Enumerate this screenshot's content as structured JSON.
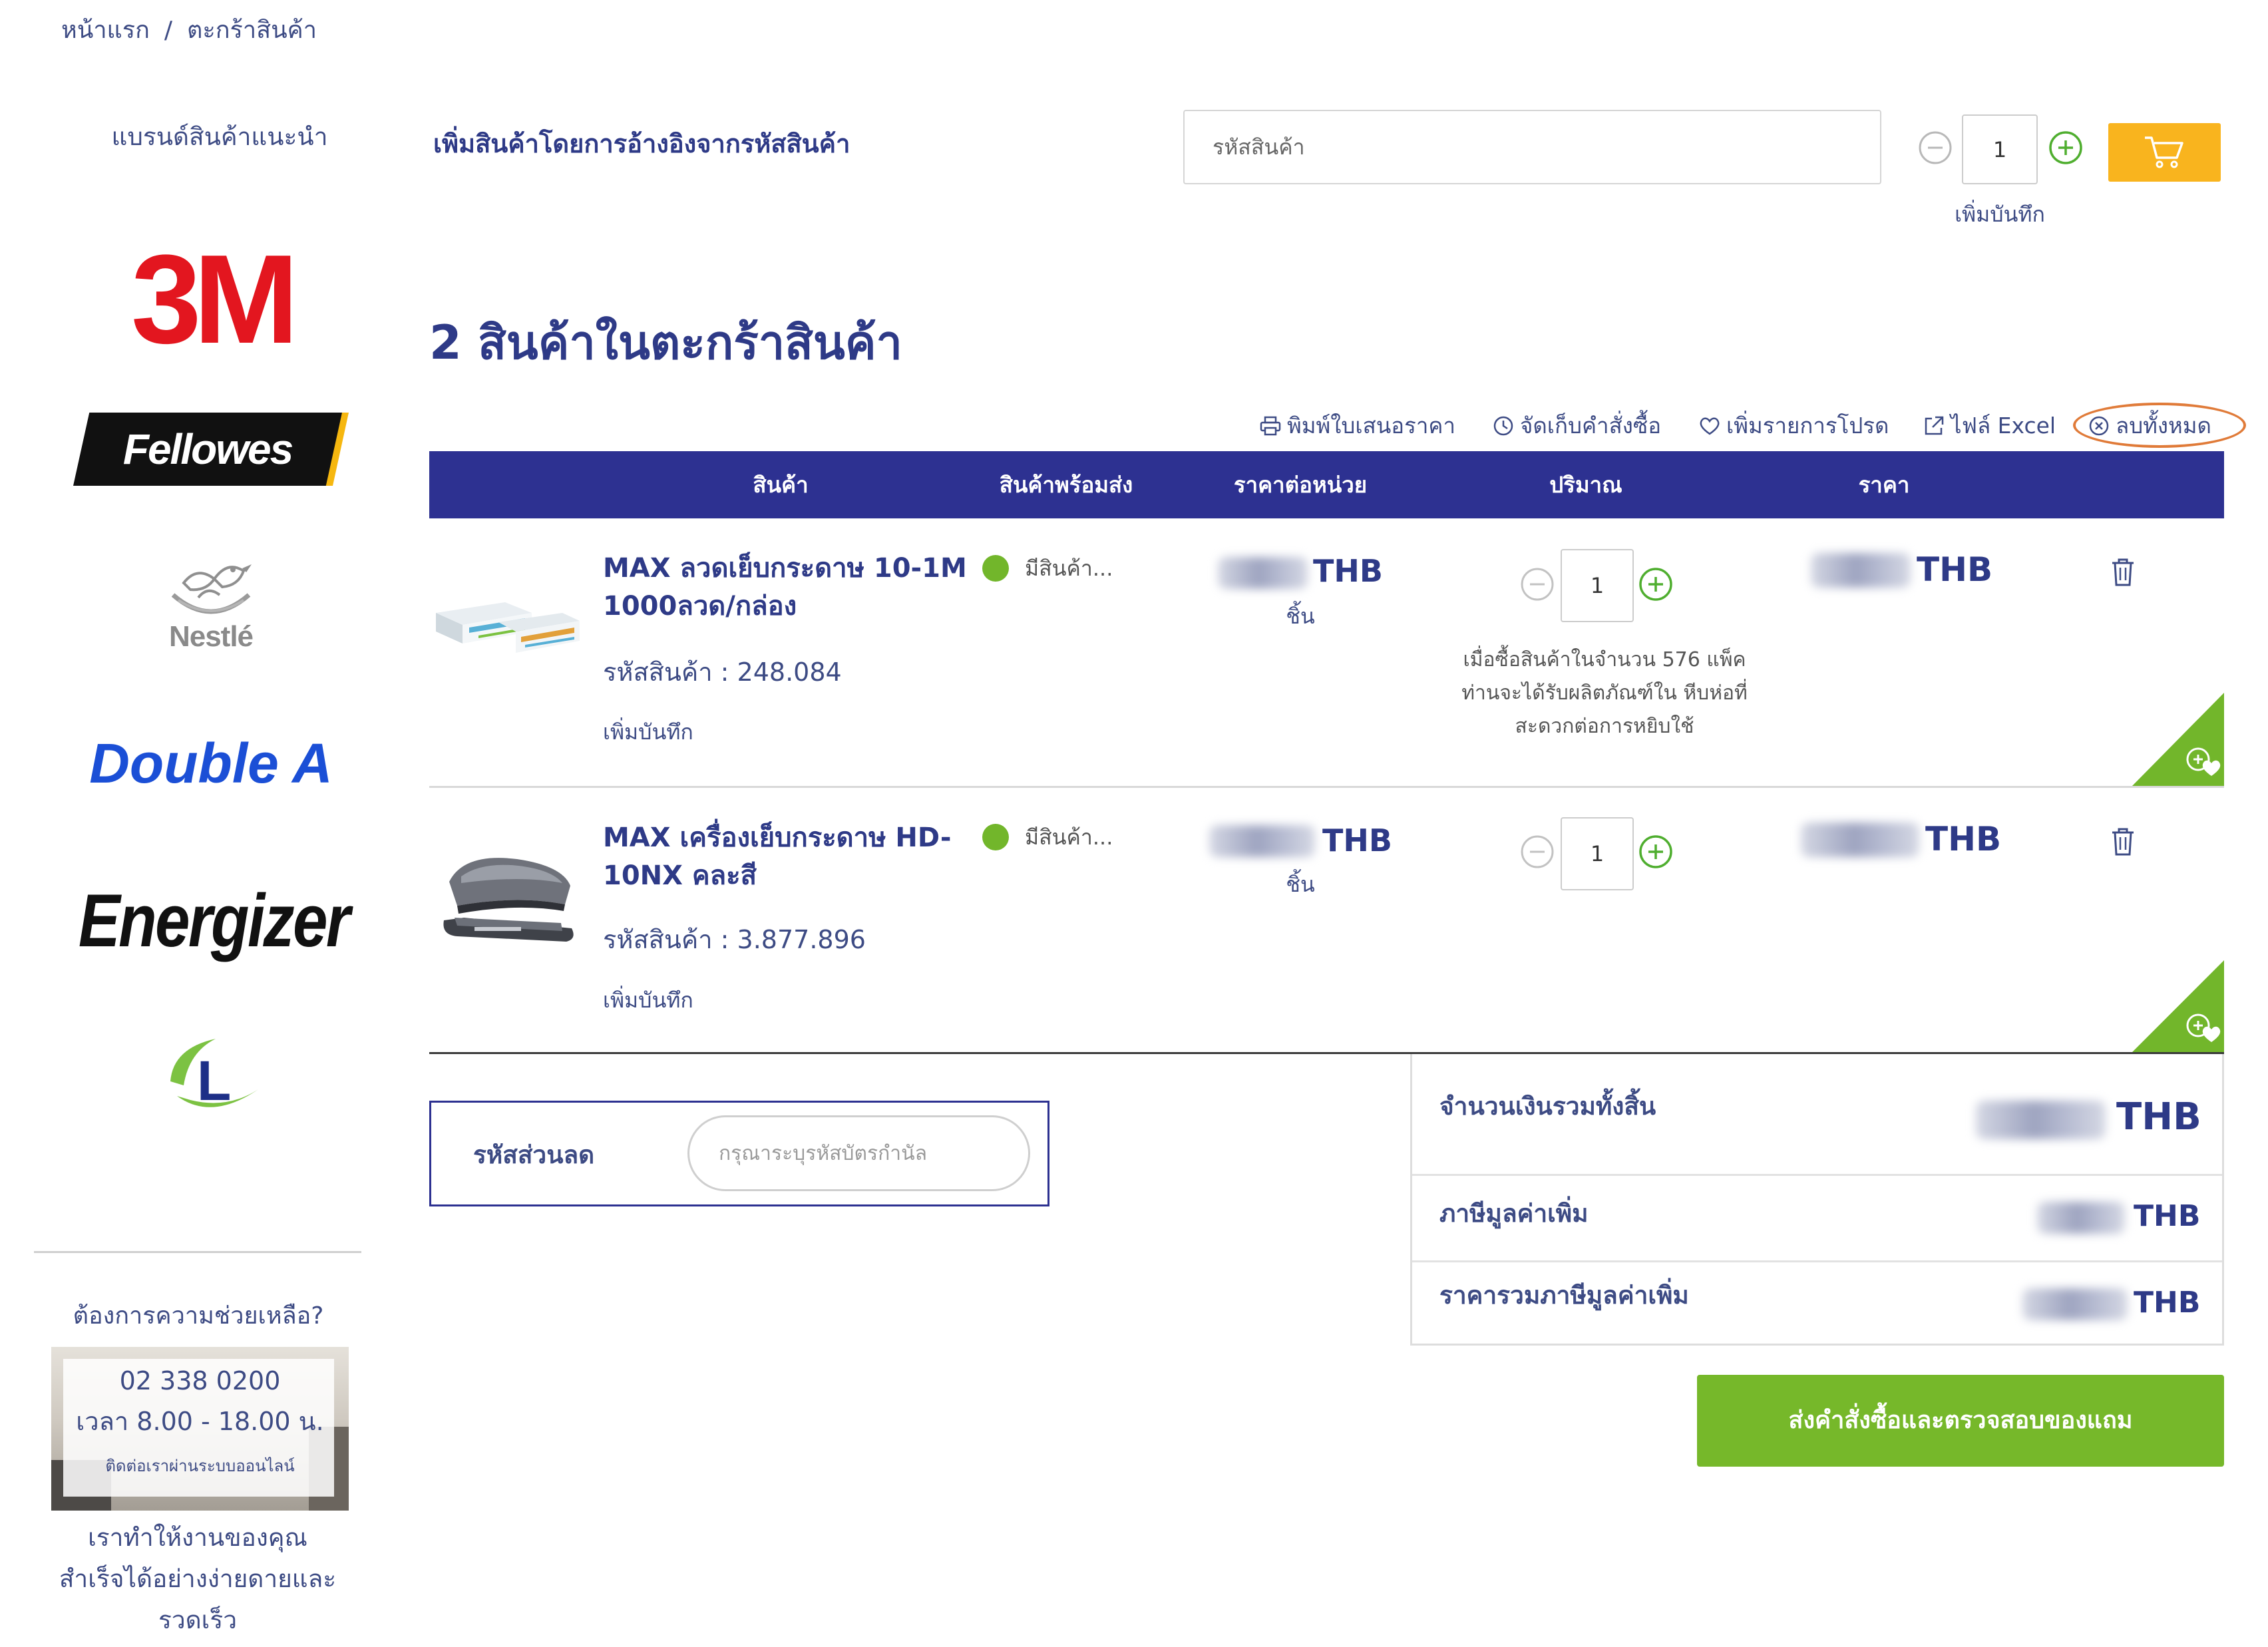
{
  "breadcrumb": {
    "home": "หน้าแรก",
    "separator": "/",
    "current": "ตะกร้าสินค้า"
  },
  "sidebar": {
    "brands_title": "แบรนด์สินค้าแนะนำ",
    "brands": [
      {
        "name": "3M"
      },
      {
        "name": "Fellowes"
      },
      {
        "name": "Nestlé"
      },
      {
        "name": "Double A"
      },
      {
        "name": "Energizer"
      },
      {
        "name": "L"
      }
    ],
    "help": {
      "title": "ต้องการความช่วยเหลือ?",
      "phone": "02 338 0200",
      "hours": "เวลา 8.00 - 18.00 น.",
      "contact_online": "ติดต่อเราผ่านระบบออนไลน์",
      "tagline_lines": [
        "เราทำให้งานของคุณ",
        "สำเร็จได้อย่างง่ายดายและ",
        "รวดเร็ว"
      ]
    }
  },
  "quick_add": {
    "title": "เพิ่มสินค้าโดยการอ้างอิงจากรหัสสินค้า",
    "placeholder": "รหัสสินค้า",
    "quantity": "1",
    "note_label": "เพิ่มบันทึก"
  },
  "cart": {
    "heading": "2 สินค้าในตะกร้าสินค้า",
    "actions": {
      "print_quote": "พิมพ์ใบเสนอราคา",
      "save_order": "จัดเก็บคำสั่งซื้อ",
      "add_favorites": "เพิ่มรายการโปรด",
      "excel_file": "ไฟล์ Excel",
      "delete_all": "ลบทั้งหมด"
    },
    "columns": [
      "สินค้า",
      "สินค้าพร้อมส่ง",
      "ราคาต่อหน่วย",
      "ปริมาณ",
      "ราคา"
    ],
    "items": [
      {
        "name": "MAX ลวดเย็บกระดาษ 10-1M 1000ลวด/กล่อง",
        "code": "รหัสสินค้า : 248.084",
        "note_link": "เพิ่มบันทึก",
        "stock": "มีสินค้า...",
        "unit_currency": "THB",
        "unit": "ชิ้น",
        "quantity": "1",
        "quantity_note": "เมื่อซื้อสินค้าในจำนวน 576 แพ็ค ท่านจะได้รับผลิตภัณฑ์ใน หีบห่อที่สะดวกต่อการหยิบใช้",
        "price_currency": "THB"
      },
      {
        "name": "MAX เครื่องเย็บกระดาษ HD-10NX คละสี",
        "code": "รหัสสินค้า : 3.877.896",
        "note_link": "เพิ่มบันทึก",
        "stock": "มีสินค้า...",
        "unit_currency": "THB",
        "unit": "ชิ้น",
        "quantity": "1",
        "price_currency": "THB"
      }
    ]
  },
  "discount": {
    "label": "รหัสส่วนลด",
    "placeholder": "กรุณาระบุรหัสบัตรกำนัล"
  },
  "summary": {
    "total_label": "จำนวนเงินรวมทั้งสิ้น",
    "vat_label": "ภาษีมูลค่าเพิ่ม",
    "total_incl_vat_label": "ราคารวมภาษีมูลค่าเพิ่ม",
    "currency": "THB"
  },
  "checkout_button": "ส่งคำสั่งซื้อและตรวจสอบของแถม",
  "colors": {
    "primary_navy": "#2d3191",
    "text_navy": "#2e3a87",
    "accent_green": "#76b82a",
    "cart_orange": "#f9b41e",
    "highlight_ring": "#e07b39",
    "brand_3m_red": "#e3161f",
    "brand_doublea_blue": "#1b4fd6"
  },
  "icons": {
    "quantity_decrease": "minus-circle-icon",
    "quantity_increase": "plus-circle-icon",
    "add_to_cart": "cart-icon",
    "print_quote": "printer-icon",
    "save_order": "clock-icon",
    "add_favorites": "heart-icon",
    "excel_file": "external-link-icon",
    "delete_all": "x-circle-icon",
    "remove_item": "trash-icon",
    "corner_favorite": "heart-icon"
  }
}
